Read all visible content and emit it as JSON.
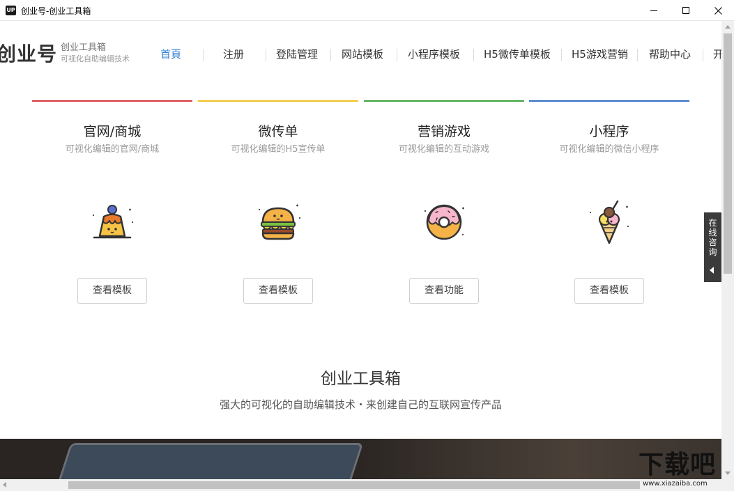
{
  "window": {
    "app_icon": "UP",
    "title": "创业号-创业工具箱"
  },
  "header": {
    "logo_main": "创业号",
    "logo_sub1": "创业工具箱",
    "logo_sub2": "可视化自助编辑技术"
  },
  "nav": {
    "items": [
      {
        "label": "首頁",
        "active": true
      },
      {
        "label": "注册"
      },
      {
        "label": "登陆管理"
      },
      {
        "label": "网站模板"
      },
      {
        "label": "小程序模板"
      },
      {
        "label": "H5微传单模板"
      },
      {
        "label": "H5游戏营销"
      },
      {
        "label": "帮助中心"
      },
      {
        "label": "开"
      }
    ]
  },
  "cards": [
    {
      "title": "官网/商城",
      "subtitle": "可视化编辑的官网/商城",
      "button": "查看模板",
      "accent": "#d9363e",
      "icon": "pudding-icon"
    },
    {
      "title": "微传单",
      "subtitle": "可视化编辑的H5宣传单",
      "button": "查看模板",
      "accent": "#f0c020",
      "icon": "burger-icon"
    },
    {
      "title": "营销游戏",
      "subtitle": "可视化编辑的互动游戏",
      "button": "查看功能",
      "accent": "#3da23b",
      "icon": "donut-icon"
    },
    {
      "title": "小程序",
      "subtitle": "可视化编辑的微信小程序",
      "button": "查看模板",
      "accent": "#2f6fc4",
      "icon": "icecream-icon"
    }
  ],
  "section": {
    "title": "创业工具箱",
    "subtitle": "强大的可视化的自助编辑技术・来创建自己的互联网宣传产品"
  },
  "consult": {
    "label": "在线咨询"
  },
  "watermark": {
    "main": "下载吧",
    "url": "www.xiazaiba.com"
  },
  "colors": {
    "nav_active": "#2f7fd4",
    "consult_bg": "#3b3b3b"
  }
}
